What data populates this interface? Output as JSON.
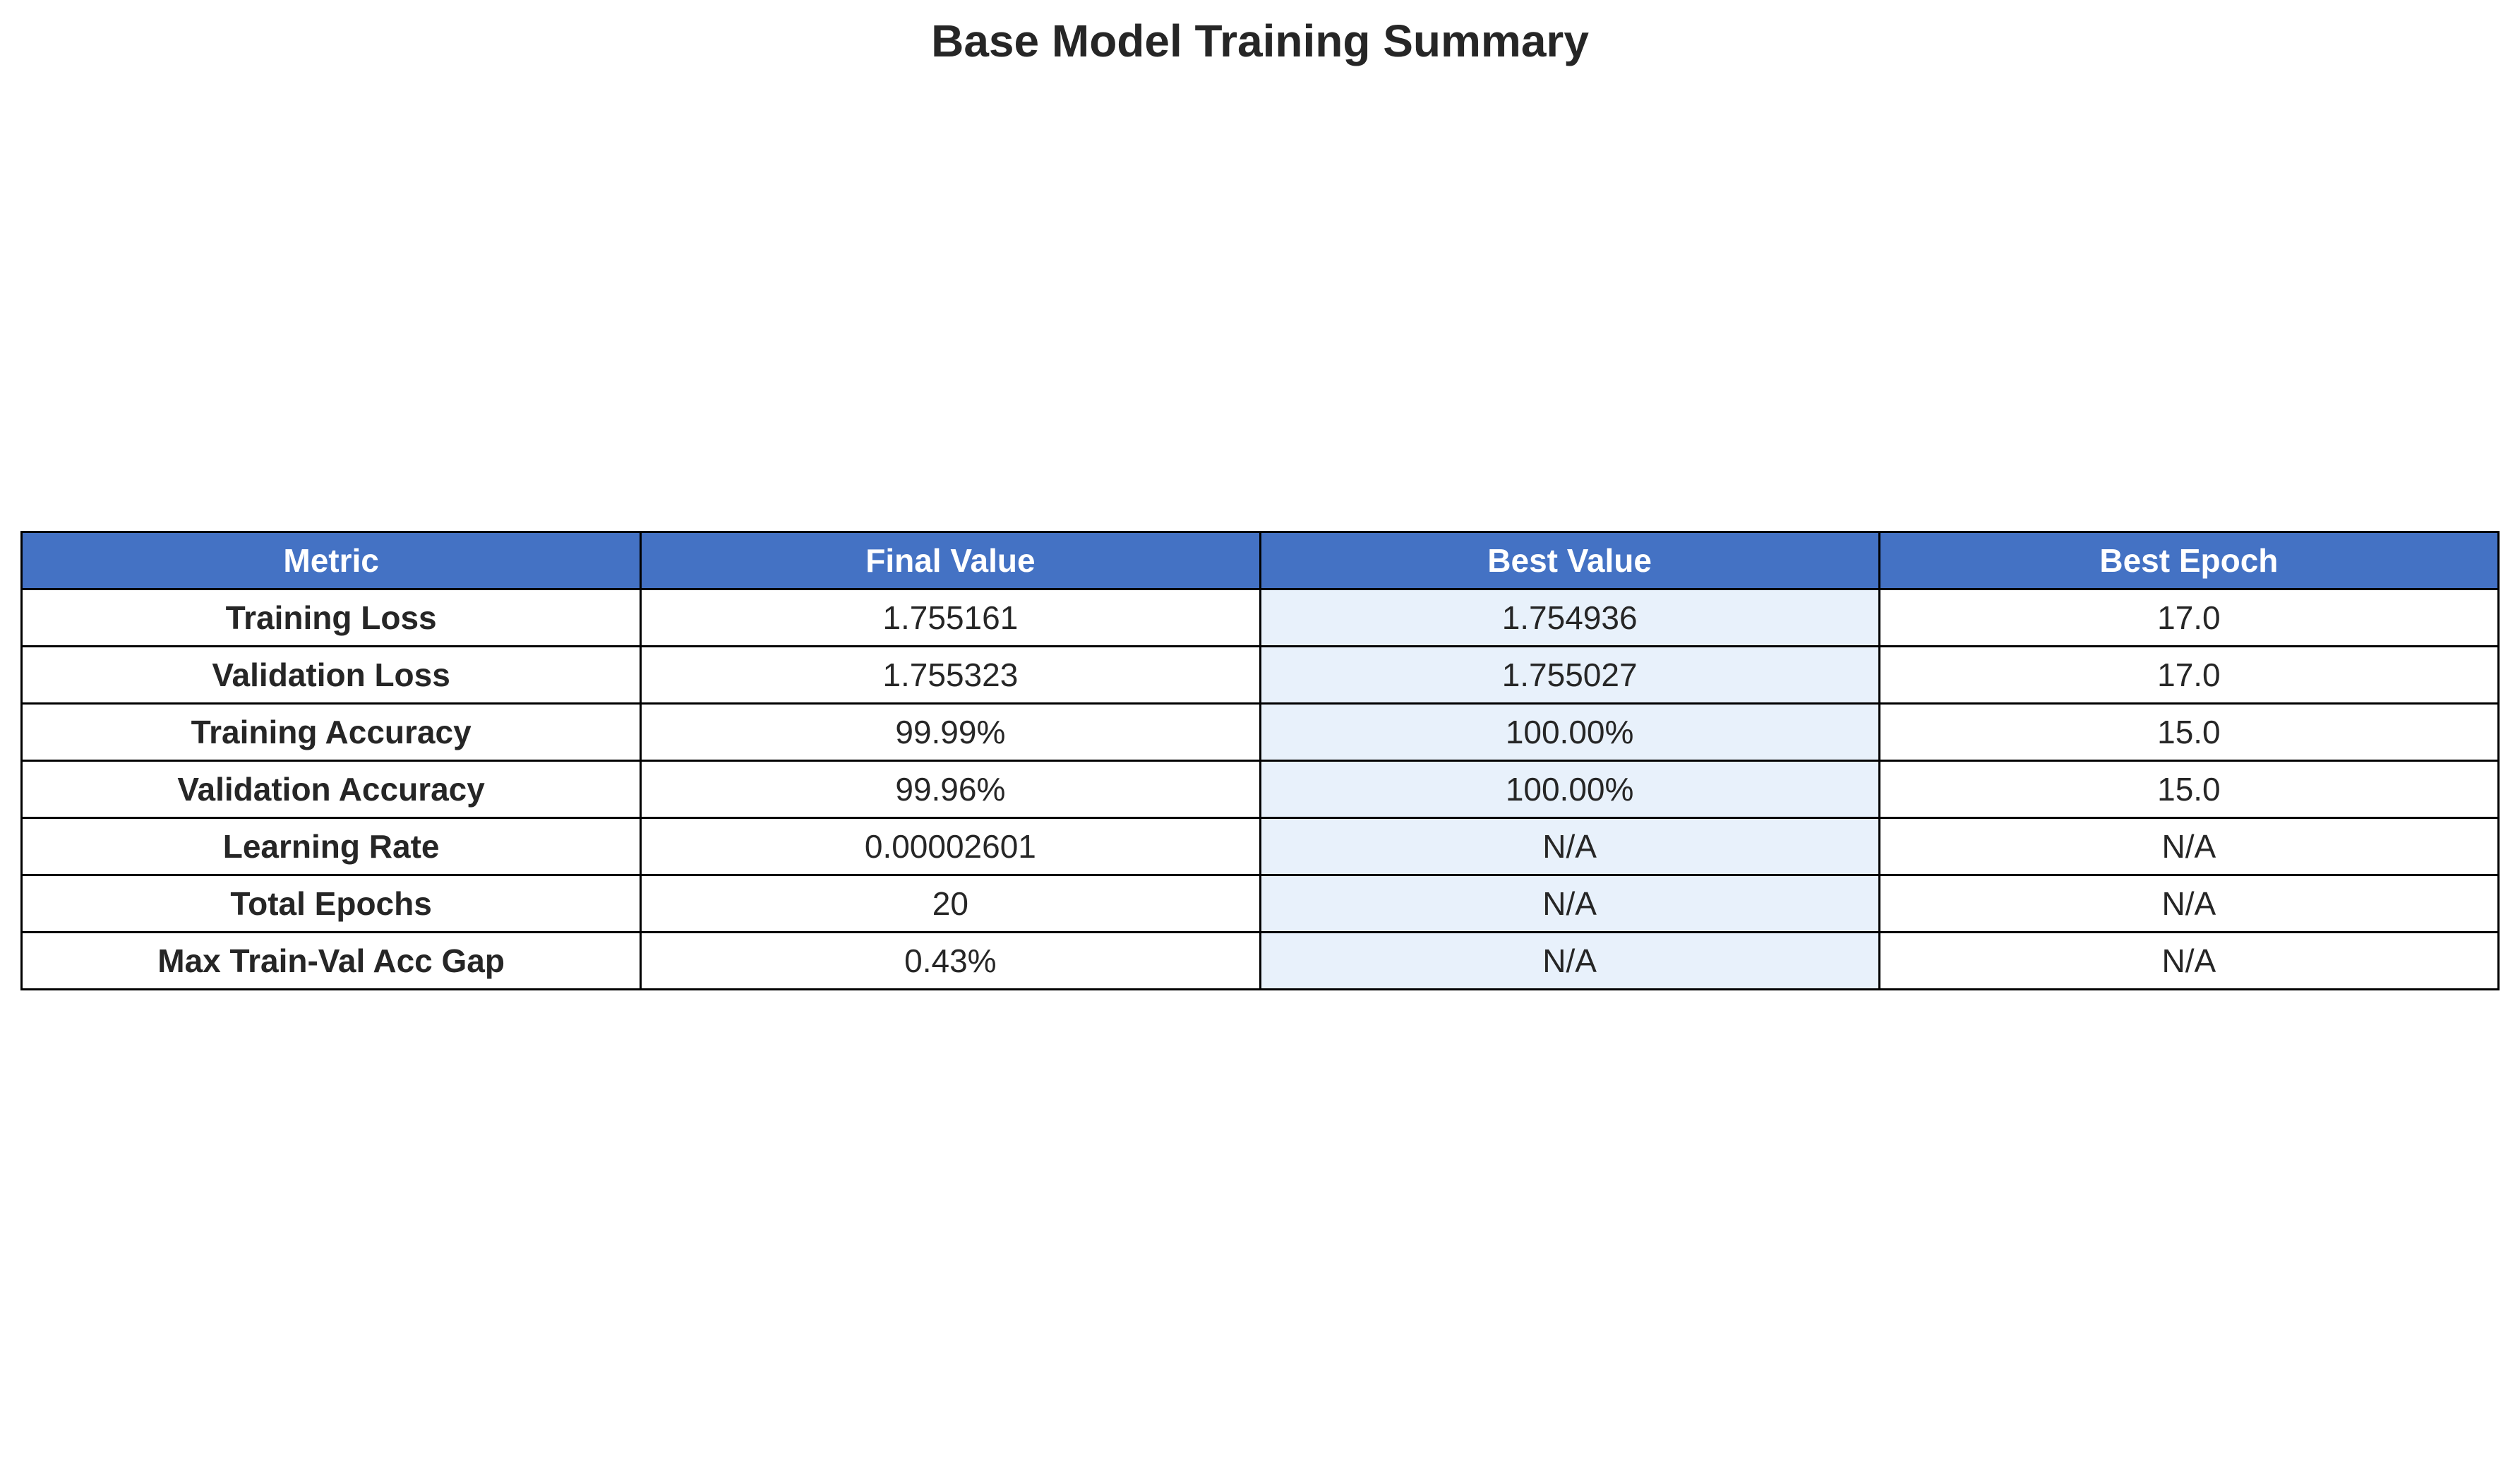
{
  "title": "Base Model Training Summary",
  "colors": {
    "header_bg": "#4472c4",
    "header_text": "#ffffff",
    "highlight_column_bg": "#e8f1fb",
    "border": "#000000",
    "text": "#262626"
  },
  "chart_data": {
    "type": "table",
    "title": "Base Model Training Summary",
    "columns": [
      "Metric",
      "Final Value",
      "Best Value",
      "Best Epoch"
    ],
    "rows": [
      [
        "Training Loss",
        "1.755161",
        "1.754936",
        "17.0"
      ],
      [
        "Validation Loss",
        "1.755323",
        "1.755027",
        "17.0"
      ],
      [
        "Training Accuracy",
        "99.99%",
        "100.00%",
        "15.0"
      ],
      [
        "Validation Accuracy",
        "99.96%",
        "100.00%",
        "15.0"
      ],
      [
        "Learning Rate",
        "0.00002601",
        "N/A",
        "N/A"
      ],
      [
        "Total Epochs",
        "20",
        "N/A",
        "N/A"
      ],
      [
        "Max Train-Val Acc Gap",
        "0.43%",
        "N/A",
        "N/A"
      ]
    ],
    "highlighted_column": "Best Value"
  }
}
